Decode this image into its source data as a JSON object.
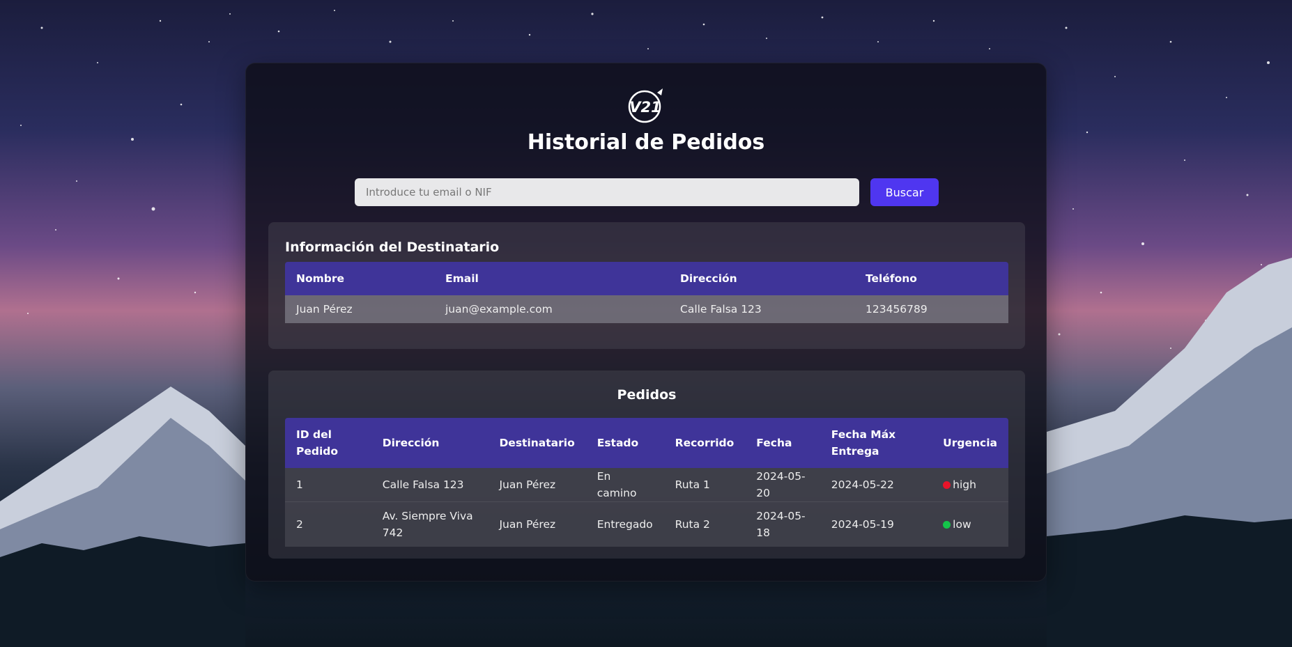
{
  "page": {
    "title": "Historial de Pedidos",
    "logo_text": "V21"
  },
  "search": {
    "placeholder": "Introduce tu email o NIF",
    "value": "",
    "button_label": "Buscar"
  },
  "recipient": {
    "section_title": "Información del Destinatario",
    "headers": [
      "Nombre",
      "Email",
      "Dirección",
      "Teléfono"
    ],
    "row": {
      "nombre": "Juan Pérez",
      "email": "juan@example.com",
      "direccion": "Calle Falsa 123",
      "telefono": "123456789"
    }
  },
  "orders": {
    "section_title": "Pedidos",
    "headers": [
      "ID del Pedido",
      "Dirección",
      "Destinatario",
      "Estado",
      "Recorrido",
      "Fecha",
      "Fecha Máx Entrega",
      "Urgencia"
    ],
    "rows": [
      {
        "id": "1",
        "direccion": "Calle Falsa 123",
        "destinatario": "Juan Pérez",
        "estado": "En camino",
        "recorrido": "Ruta 1",
        "fecha": "2024-05-20",
        "fecha_max": "2024-05-22",
        "urgencia": "high",
        "urgencia_color": "#e8142a"
      },
      {
        "id": "2",
        "direccion": "Av. Siempre Viva 742",
        "destinatario": "Juan Pérez",
        "estado": "Entregado",
        "recorrido": "Ruta 2",
        "fecha": "2024-05-18",
        "fecha_max": "2024-05-19",
        "urgencia": "low",
        "urgencia_color": "#14c44a"
      }
    ]
  },
  "colors": {
    "accent": "#4f36f0",
    "table_header": "#3f3499"
  }
}
